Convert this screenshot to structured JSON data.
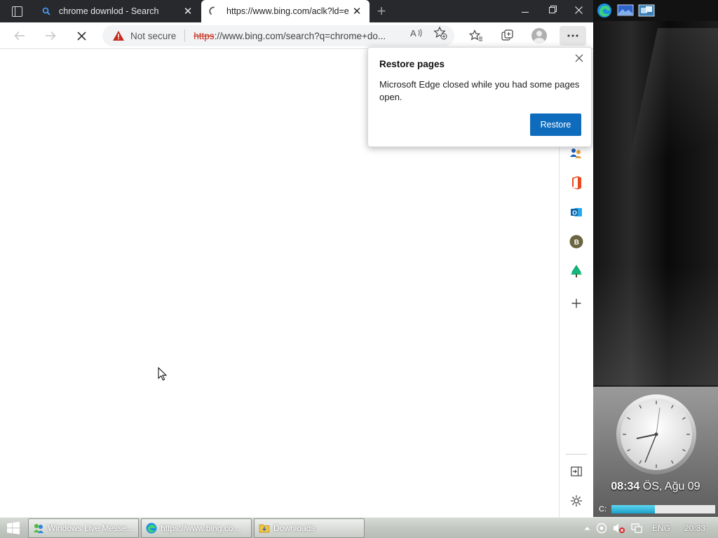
{
  "browser": {
    "tabs": [
      {
        "title": "chrome downlod - Search",
        "state": "inactive",
        "icon": "search-icon"
      },
      {
        "title": "https://www.bing.com/aclk?ld=e",
        "state": "active",
        "icon": "loading-spinner-icon"
      }
    ],
    "toolbar": {
      "security_label": "Not secure",
      "url_scheme": "https",
      "url_rest": "://www.bing.com/search?q=chrome+do..."
    }
  },
  "restore_popup": {
    "title": "Restore pages",
    "message": "Microsoft Edge closed while you had some pages open.",
    "button_label": "Restore"
  },
  "sidebar": {
    "items": [
      "people-icon",
      "office-icon",
      "outlook-icon",
      "bing-icon",
      "tree-icon",
      "add-icon",
      "open-in-window-icon",
      "settings-icon"
    ],
    "bing_badge_letter": "B"
  },
  "desktop": {
    "clock_time": "08:34",
    "clock_ampm": "ÖS,",
    "clock_date": "Ağu 09",
    "drive_label": "C:",
    "drive_used_fraction": 0.42
  },
  "taskbar": {
    "buttons": [
      {
        "label": "Windows Live Messe...",
        "icon": "messenger-icon"
      },
      {
        "label": "https://www.bing.co...",
        "icon": "edge-icon"
      },
      {
        "label": "Downloads",
        "icon": "folder-icon"
      }
    ],
    "tray": {
      "language": "ENG",
      "time": "20:33"
    }
  },
  "colors": {
    "tabstrip": "#27292d",
    "accent": "#0f6cbd",
    "insecure": "#c42b1c"
  }
}
